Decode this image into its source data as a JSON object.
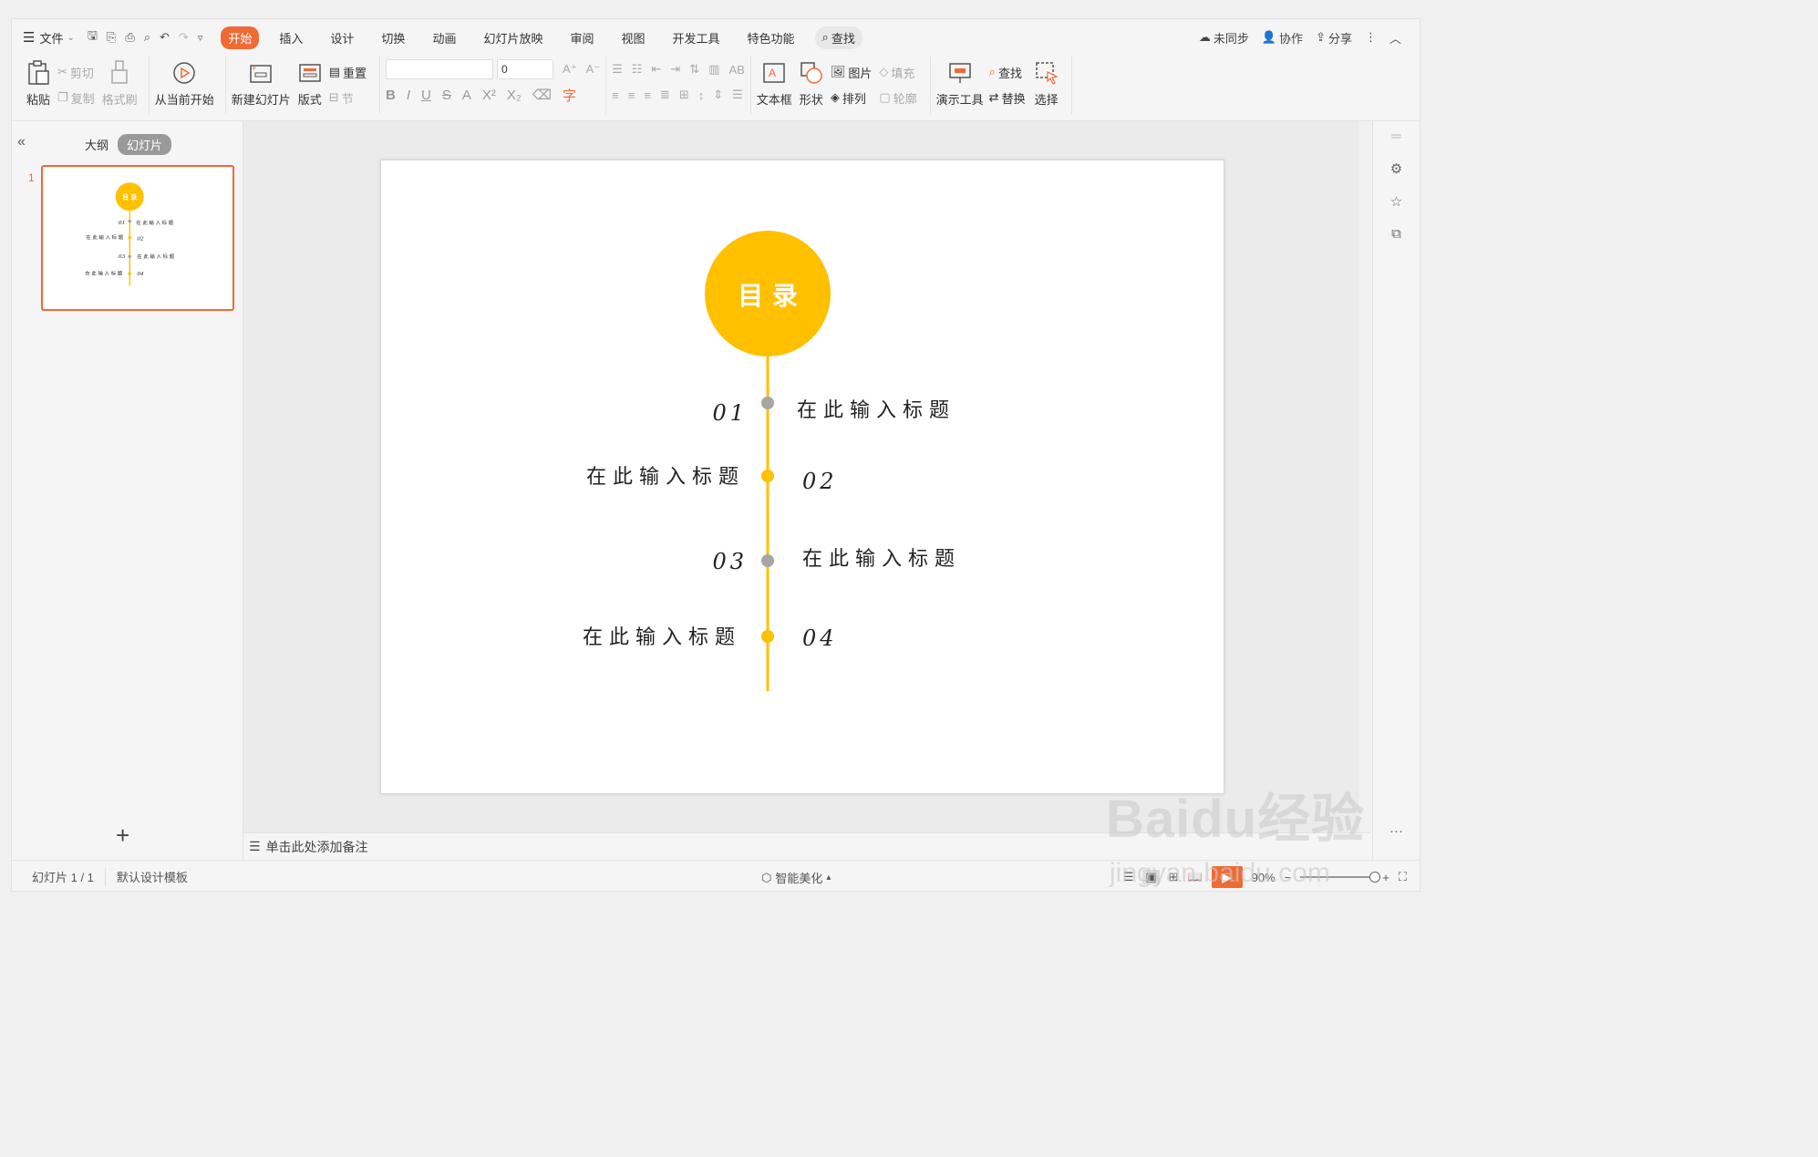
{
  "menubar": {
    "file_label": "文件",
    "tabs": [
      "开始",
      "插入",
      "设计",
      "切换",
      "动画",
      "幻灯片放映",
      "审阅",
      "视图",
      "开发工具",
      "特色功能"
    ],
    "active_tab": "开始",
    "search_label": "查找",
    "right": {
      "sync": "未同步",
      "collab": "协作",
      "share": "分享"
    }
  },
  "ribbon": {
    "paste": "粘贴",
    "cut": "剪切",
    "copy": "复制",
    "format_painter": "格式刷",
    "start_from_current": "从当前开始",
    "new_slide": "新建幻灯片",
    "layout": "版式",
    "reset": "重置",
    "section": "节",
    "font_name": "",
    "font_size": "0",
    "textbox": "文本框",
    "shape": "形状",
    "picture": "图片",
    "fill": "填充",
    "arrange": "排列",
    "outline": "轮廓",
    "presentation_tools": "演示工具",
    "find": "查找",
    "replace": "替换",
    "select": "选择"
  },
  "left_panel": {
    "tab_outline": "大纲",
    "tab_slides": "幻灯片",
    "slide_number": "1"
  },
  "slide": {
    "title": "目 录",
    "items": [
      {
        "num": "01",
        "text": "在 此 输 入 标 题",
        "dot_color": "#a6a6a6"
      },
      {
        "num": "02",
        "text": "在 此 输 入 标 题",
        "dot_color": "#ffc000"
      },
      {
        "num": "03",
        "text": "在 此 输 入 标 题",
        "dot_color": "#a6a6a6"
      },
      {
        "num": "04",
        "text": "在 此 输 入 标 题",
        "dot_color": "#ffc000"
      }
    ],
    "accent_color": "#ffc000"
  },
  "notes": {
    "placeholder": "单击此处添加备注"
  },
  "status": {
    "slide_info": "幻灯片 1 / 1",
    "template": "默认设计模板",
    "smart_beautify": "智能美化",
    "zoom": "90%"
  },
  "watermark": {
    "main": "Baidu经验",
    "url": "jingyan.baidu.com"
  }
}
